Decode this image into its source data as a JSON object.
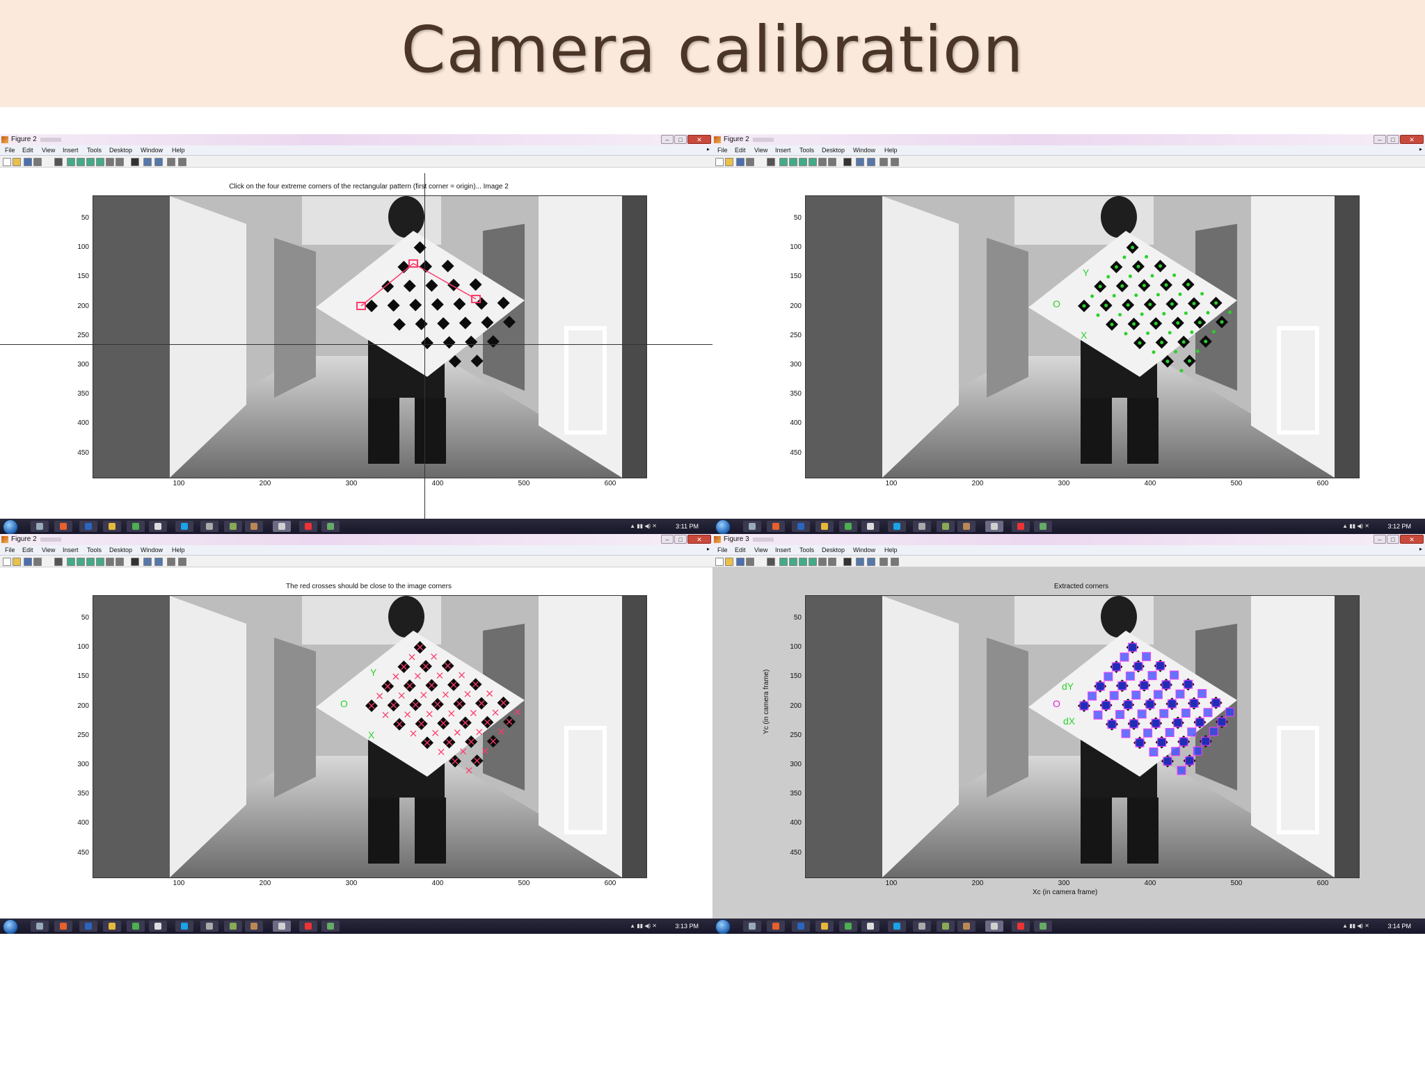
{
  "slide": {
    "title": "Camera calibration"
  },
  "menu": [
    "File",
    "Edit",
    "View",
    "Insert",
    "Tools",
    "Desktop",
    "Window",
    "Help"
  ],
  "y_ticks": [
    "50",
    "100",
    "150",
    "200",
    "250",
    "300",
    "350",
    "400",
    "450"
  ],
  "x_ticks": [
    "100",
    "200",
    "300",
    "400",
    "500",
    "600"
  ],
  "windows": [
    {
      "title": "Figure 2",
      "plot_title": "Click on the four extreme corners of the rectangular pattern (first corner = origin)... Image 2",
      "clock": "3:11 PM"
    },
    {
      "title": "Figure 2",
      "plot_title": "",
      "clock": "3:12 PM",
      "labels": {
        "o": "O",
        "x": "X",
        "y": "Y"
      }
    },
    {
      "title": "Figure 2",
      "plot_title": "The red crosses should be close to the image corners",
      "clock": "3:13 PM",
      "labels": {
        "o": "O",
        "x": "X",
        "y": "Y"
      }
    },
    {
      "title": "Figure 3",
      "plot_title": "Extracted corners",
      "clock": "3:14 PM",
      "xlabel": "Xc (in camera frame)",
      "ylabel": "Yc (in camera frame)",
      "labels": {
        "o": "O",
        "x": "dX",
        "y": "dY"
      }
    }
  ],
  "colors": {
    "banner_bg": "#fbe9dc",
    "title_text": "#4a3526",
    "corner_green": "#2bd12b",
    "cross_red": "#ff3b6b",
    "origin_magenta": "#e020e0",
    "overlay_blue": "#2a3cff"
  },
  "icons": {
    "window_controls": [
      "minimize-icon",
      "maximize-icon",
      "close-icon"
    ],
    "taskbar": [
      "start-orb-icon",
      "explorer-icon",
      "firefox-icon",
      "matlab-icon",
      "chrome-icon",
      "app-icon",
      "chat-icon",
      "skype-icon",
      "app-icon",
      "app-icon",
      "figure-icon",
      "app-icon",
      "powerpoint-icon",
      "paint-icon"
    ]
  }
}
